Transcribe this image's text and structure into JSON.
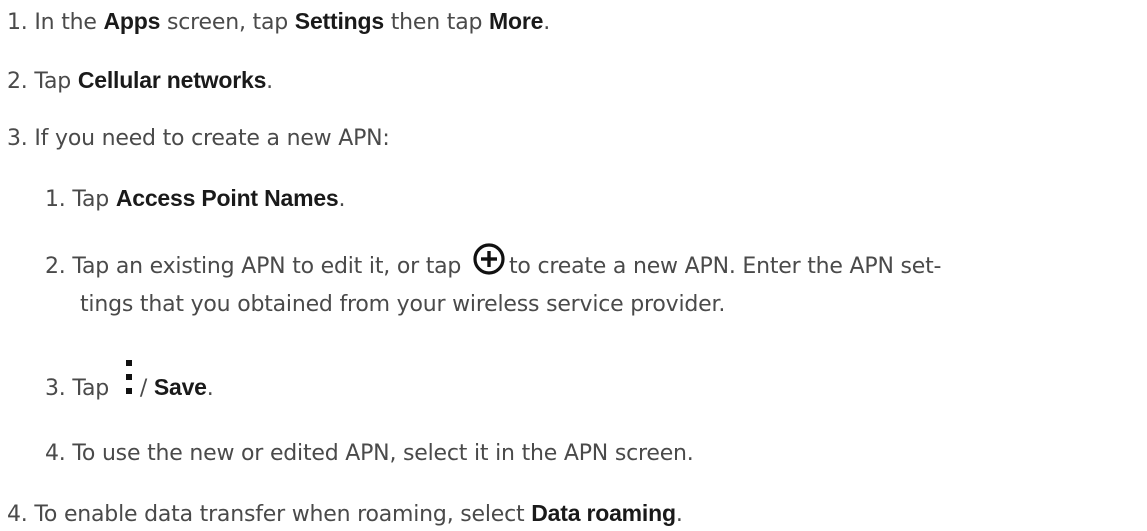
{
  "steps": [
    {
      "number": "1.",
      "parts": [
        "In the ",
        "Apps",
        " screen, tap ",
        "Settings",
        " then tap ",
        "More",
        "."
      ]
    },
    {
      "number": "2.",
      "parts": [
        "Tap ",
        "Cellular networks",
        "."
      ]
    },
    {
      "number": "3.",
      "parts": [
        "If you need to create a new APN:"
      ],
      "substeps": [
        {
          "number": "1.",
          "parts": [
            "Tap ",
            "Access Point Names",
            "."
          ]
        },
        {
          "number": "2.",
          "parts": [
            "Tap an existing APN to edit it, or tap ",
            "to create a new APN. Enter the APN set-"
          ],
          "continuation": "tings that you obtained from your wireless service provider.",
          "icon": "add-circle-icon"
        },
        {
          "number": "3.",
          "parts": [
            "Tap ",
            "/ ",
            "Save",
            "."
          ],
          "icon": "more-vert-icon"
        },
        {
          "number": "4.",
          "parts": [
            "To use the new or edited APN, select it in the APN screen."
          ]
        }
      ]
    },
    {
      "number": "4.",
      "parts": [
        "To enable data transfer when roaming, select ",
        "Data roaming",
        "."
      ]
    }
  ]
}
